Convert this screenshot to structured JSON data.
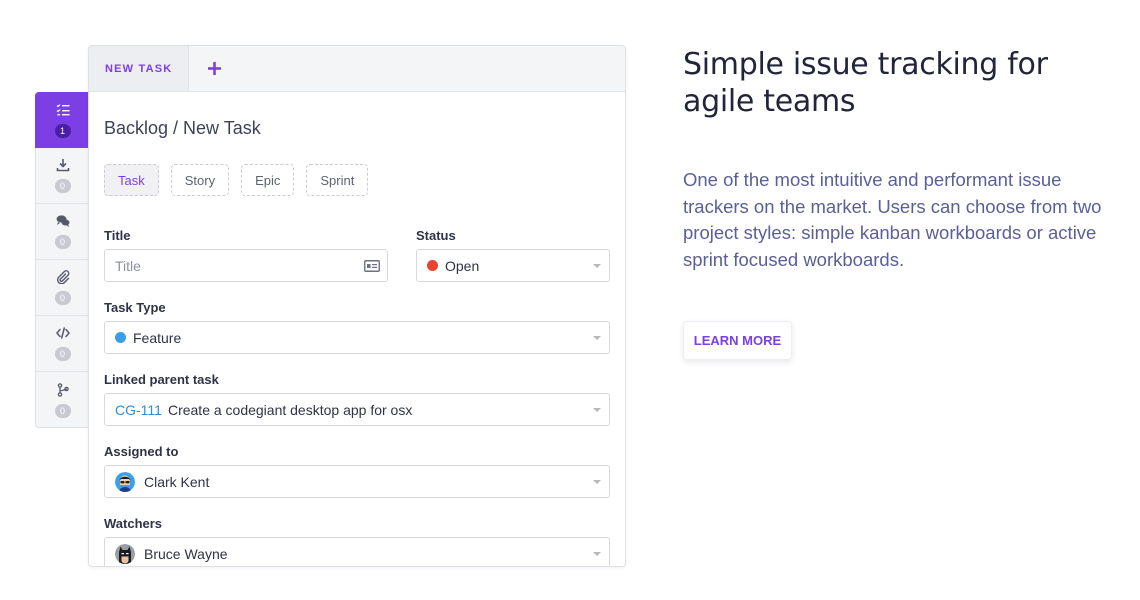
{
  "tab": {
    "label": "NEW TASK",
    "add_icon": "plus-icon"
  },
  "rail": [
    {
      "icon": "checklist-icon",
      "count": "1"
    },
    {
      "icon": "download-icon",
      "count": "0"
    },
    {
      "icon": "comments-icon",
      "count": "0"
    },
    {
      "icon": "paperclip-icon",
      "count": "0"
    },
    {
      "icon": "code-icon",
      "count": "0"
    },
    {
      "icon": "branch-icon",
      "count": "0"
    }
  ],
  "breadcrumb": "Backlog / New Task",
  "issue_types": [
    "Task",
    "Story",
    "Epic",
    "Sprint"
  ],
  "form": {
    "title": {
      "label": "Title",
      "placeholder": "Title"
    },
    "status": {
      "label": "Status",
      "value": "Open",
      "color": "#e8432e"
    },
    "task_type": {
      "label": "Task Type",
      "value": "Feature",
      "color": "#3b9ee3"
    },
    "linked_parent": {
      "label": "Linked parent task",
      "key": "CG-111",
      "value": "Create a codegiant desktop app for osx"
    },
    "assigned_to": {
      "label": "Assigned to",
      "value": "Clark Kent"
    },
    "watchers": {
      "label": "Watchers",
      "value": "Bruce Wayne"
    }
  },
  "hero": {
    "headline": "Simple issue tracking for agile teams",
    "description": "One of the most intuitive and performant issue trackers on the market. Users can choose from two project styles: simple kanban workboards or active sprint focused workboards.",
    "cta": "LEARN MORE"
  },
  "colors": {
    "accent": "#7b3fe4",
    "link": "#2d8bd8",
    "description": "#5a5f96"
  }
}
